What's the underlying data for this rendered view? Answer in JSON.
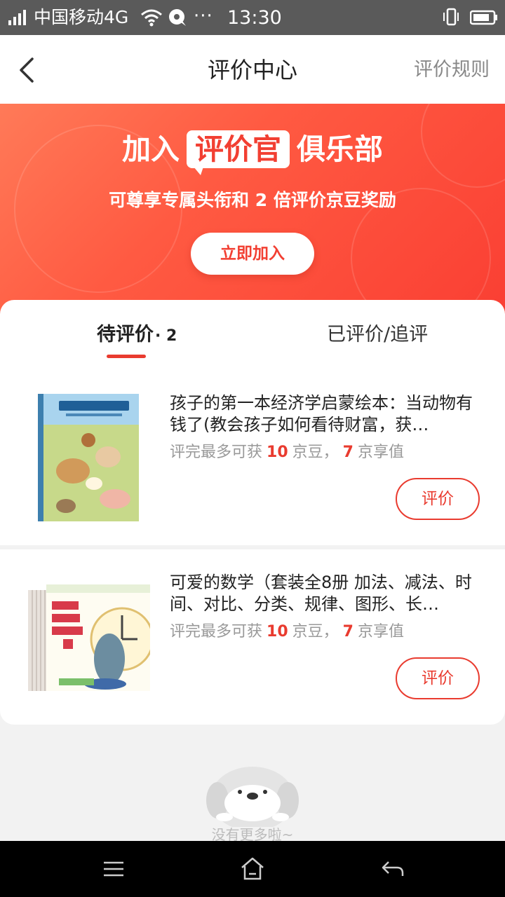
{
  "status_bar": {
    "carrier": "中国移动4G",
    "dots": "···",
    "time": "13:30"
  },
  "header": {
    "title": "评价中心",
    "rules_link": "评价规则"
  },
  "banner": {
    "title_prefix": "加入",
    "title_badge": "评价官",
    "title_suffix": "俱乐部",
    "subtitle": "可尊享专属头衔和 2 倍评价京豆奖励",
    "join_button": "立即加入"
  },
  "tabs": {
    "pending_label": "待评价",
    "pending_count": "· 2",
    "done_label": "已评价/追评"
  },
  "items": [
    {
      "name": "孩子的第一本经济学启蒙绘本：当动物有钱了(教会孩子如何看待财富，获…",
      "reward_prefix": "评完最多可获",
      "beans": "10",
      "beans_unit": "京豆，",
      "value": "7",
      "value_unit": "京享值",
      "button": "评价"
    },
    {
      "name": "可爱的数学（套装全8册 加法、减法、时间、对比、分类、规律、图形、长…",
      "reward_prefix": "评完最多可获",
      "beans": "10",
      "beans_unit": "京豆，",
      "value": "7",
      "value_unit": "京享值",
      "button": "评价"
    }
  ],
  "footer": {
    "no_more": "没有更多啦~"
  },
  "colors": {
    "accent": "#e93b2f",
    "banner_start": "#ff7a58",
    "banner_end": "#fa3f33"
  }
}
